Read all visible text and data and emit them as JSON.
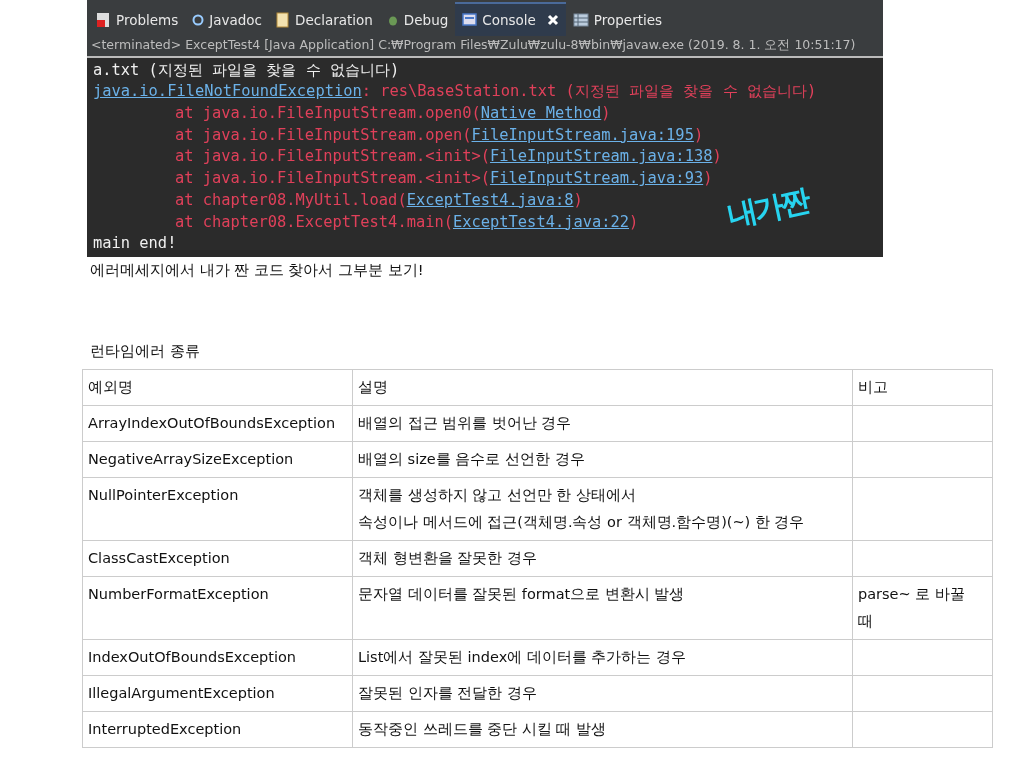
{
  "console_view": {
    "tabs": [
      {
        "label": "Problems",
        "selected": false
      },
      {
        "label": "Javadoc",
        "selected": false
      },
      {
        "label": "Declaration",
        "selected": false
      },
      {
        "label": "Debug",
        "selected": false
      },
      {
        "label": "Console",
        "selected": true
      },
      {
        "label": "Properties",
        "selected": false
      }
    ],
    "status": "<terminated> ExceptTest4 [Java Application] C:₩Program Files₩Zulu₩zulu-8₩bin₩javaw.exe (2019. 8. 1. 오전 10:51:17)",
    "lines": [
      {
        "indent": false,
        "segments": [
          {
            "kind": "plain",
            "text": "a.txt (지정된 파일을 찾을 수 없습니다)"
          }
        ]
      },
      {
        "indent": false,
        "segments": [
          {
            "kind": "link",
            "text": "java.io.FileNotFoundException"
          },
          {
            "kind": "error",
            "text": ": res\\BaseStation.txt (지정된 파일을 찾을 수 없습니다)"
          }
        ]
      },
      {
        "indent": true,
        "segments": [
          {
            "kind": "error",
            "text": "at java.io.FileInputStream.open0("
          },
          {
            "kind": "link",
            "text": "Native Method"
          },
          {
            "kind": "error",
            "text": ")"
          }
        ]
      },
      {
        "indent": true,
        "segments": [
          {
            "kind": "error",
            "text": "at java.io.FileInputStream.open("
          },
          {
            "kind": "link",
            "text": "FileInputStream.java:195"
          },
          {
            "kind": "error",
            "text": ")"
          }
        ]
      },
      {
        "indent": true,
        "segments": [
          {
            "kind": "error",
            "text": "at java.io.FileInputStream.<init>("
          },
          {
            "kind": "link",
            "text": "FileInputStream.java:138"
          },
          {
            "kind": "error",
            "text": ")"
          }
        ]
      },
      {
        "indent": true,
        "segments": [
          {
            "kind": "error",
            "text": "at java.io.FileInputStream.<init>("
          },
          {
            "kind": "link",
            "text": "FileInputStream.java:93"
          },
          {
            "kind": "error",
            "text": ")"
          }
        ]
      },
      {
        "indent": true,
        "segments": [
          {
            "kind": "error",
            "text": "at chapter08.MyUtil.load("
          },
          {
            "kind": "link",
            "text": "ExceptTest4.java:8"
          },
          {
            "kind": "error",
            "text": ")"
          }
        ]
      },
      {
        "indent": true,
        "segments": [
          {
            "kind": "error",
            "text": "at chapter08.ExceptTest4.main("
          },
          {
            "kind": "link",
            "text": "ExceptTest4.java:22"
          },
          {
            "kind": "error",
            "text": ")"
          }
        ]
      },
      {
        "indent": false,
        "segments": [
          {
            "kind": "plain",
            "text": "main end!"
          }
        ]
      }
    ],
    "handwriting": "내가짠"
  },
  "caption": "에러메세지에서 내가 짠 코드 찾아서 그부분 보기!",
  "table_title": "런타임에러 종류",
  "table": {
    "columns": [
      "예외명",
      "설명",
      "비고"
    ],
    "rows": [
      [
        "ArrayIndexOutOfBoundsException",
        "배열의 접근 범위를 벗어난 경우",
        ""
      ],
      [
        "NegativeArraySizeException",
        "배열의 size를 음수로 선언한 경우",
        ""
      ],
      [
        "NullPointerException",
        "객체를 생성하지 않고 선언만 한 상태에서\n속성이나 메서드에 접근(객체명.속성 or 객체명.함수명)(~) 한 경우",
        ""
      ],
      [
        "ClassCastException",
        "객체 형변환을 잘못한 경우",
        ""
      ],
      [
        "NumberFormatException",
        "문자열 데이터를 잘못된 format으로 변환시 발생",
        "parse~ 로 바꿀 때"
      ],
      [
        "IndexOutOfBoundsException",
        "List에서 잘못된 index에 데이터를 추가하는 경우",
        ""
      ],
      [
        "IllegalArgumentException",
        "잘못된 인자를 전달한 경우",
        ""
      ],
      [
        "InterruptedException",
        "동작중인 쓰레드를 중단 시킬 때 발생",
        ""
      ]
    ]
  }
}
